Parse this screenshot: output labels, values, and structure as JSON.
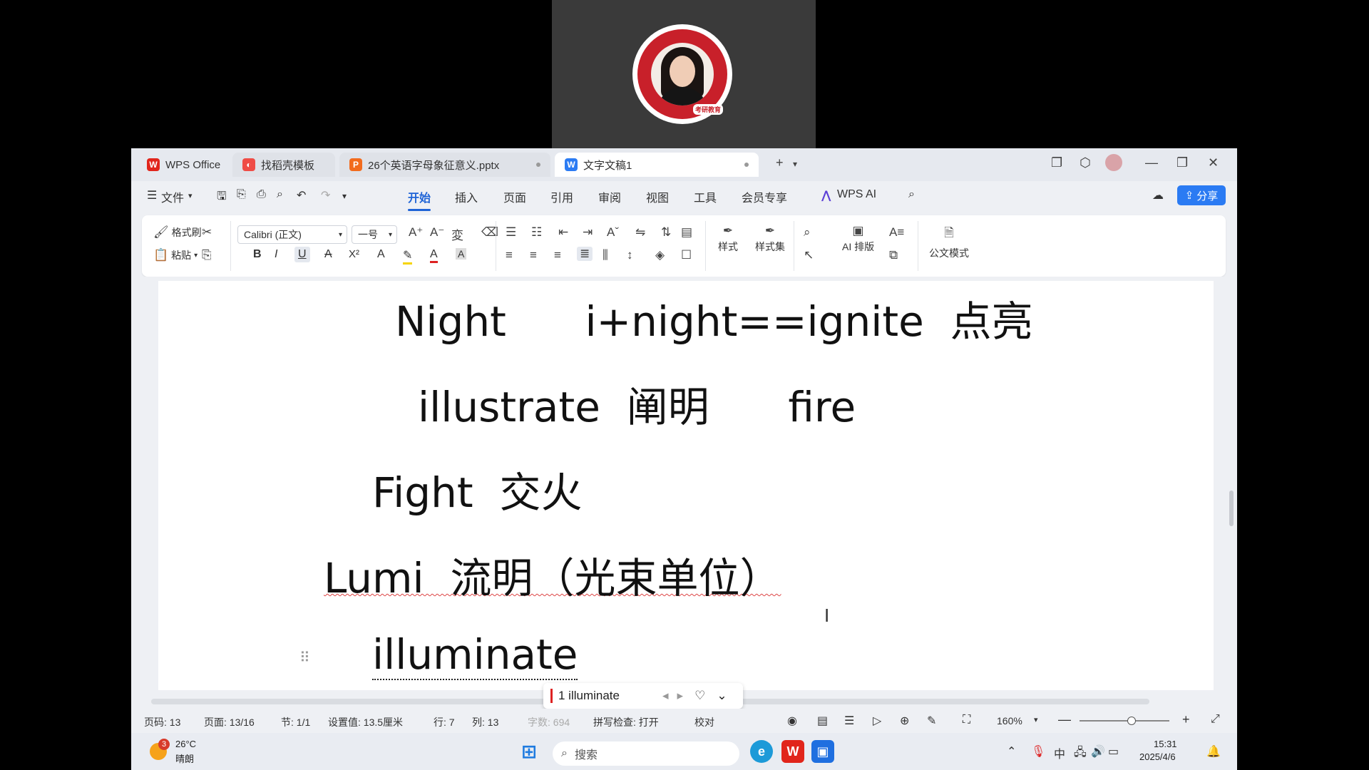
{
  "webcam": {
    "stamp": "考研教育"
  },
  "tabs": [
    {
      "label": "WPS Office",
      "icon": "wps-logo-icon",
      "color": "#e1251b"
    },
    {
      "label": "找稻壳模板",
      "icon": "docer-icon",
      "color": "#ef4c46"
    },
    {
      "label": "26个英语字母象征意义.pptx",
      "icon": "presentation-icon",
      "color": "#f26b1d"
    },
    {
      "label": "文字文稿1",
      "icon": "writer-icon",
      "color": "#2b7bf3"
    }
  ],
  "menu": {
    "file": "文件",
    "items": [
      "开始",
      "插入",
      "页面",
      "引用",
      "审阅",
      "视图",
      "工具",
      "会员专享"
    ],
    "active": "开始",
    "wps_ai": "WPS AI",
    "share": "分享"
  },
  "ribbon": {
    "format_painter": "格式刷",
    "paste": "粘贴",
    "font_name": "Calibri (正文)",
    "font_size": "一号",
    "style": "样式",
    "style_set": "样式集",
    "ai_layout": "AI 排版",
    "official_mode": "公文模式"
  },
  "document": {
    "lines": [
      "Night      i+night==ignite  点亮",
      "illustrate  阐明      fire",
      "Fight  交火",
      "Lumi  流明（光束单位）",
      "illuminate"
    ]
  },
  "popup": {
    "suggestion": "1 illuminate"
  },
  "status": {
    "page_code": "页码: 13",
    "page": "页面: 13/16",
    "section": "节: 1/1",
    "setting": "设置值: 13.5厘米",
    "row": "行: 7",
    "col": "列: 13",
    "words": "字数: 694",
    "spell": "拼写检查: 打开",
    "proof": "校对",
    "zoom": "160%"
  },
  "taskbar": {
    "weather_temp": "26°C",
    "weather_desc": "晴朗",
    "weather_badge": "3",
    "search": "搜索",
    "ime": "中",
    "time": "15:31",
    "date": "2025/4/6"
  }
}
